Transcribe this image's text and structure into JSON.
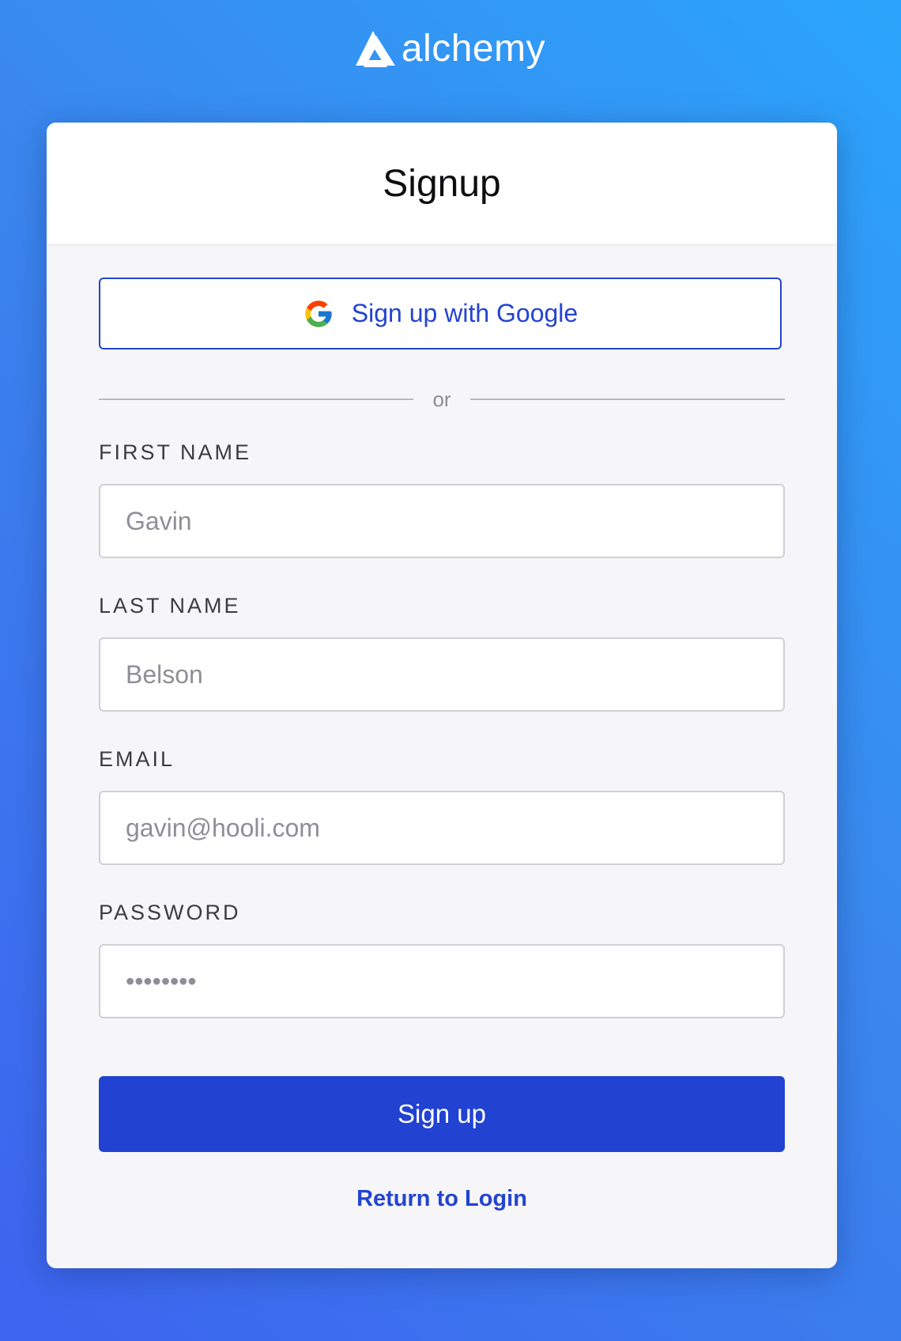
{
  "brand": {
    "name": "alchemy",
    "logo_icon": "alchemy-logo-icon"
  },
  "card": {
    "title": "Signup"
  },
  "google_button": {
    "label": "Sign up with Google",
    "icon": "google-icon"
  },
  "divider": {
    "text": "or"
  },
  "fields": {
    "first_name": {
      "label": "FIRST NAME",
      "placeholder": "Gavin",
      "value": ""
    },
    "last_name": {
      "label": "LAST NAME",
      "placeholder": "Belson",
      "value": ""
    },
    "email": {
      "label": "EMAIL",
      "placeholder": "gavin@hooli.com",
      "value": ""
    },
    "password": {
      "label": "PASSWORD",
      "placeholder": "••••••••",
      "value": ""
    }
  },
  "submit_button": {
    "label": "Sign up"
  },
  "return_link": {
    "label": "Return to Login"
  },
  "colors": {
    "accent": "#2242d2",
    "background_start": "#2ba5fb",
    "background_end": "#3d63ef",
    "card_background": "#f6f6f8"
  }
}
